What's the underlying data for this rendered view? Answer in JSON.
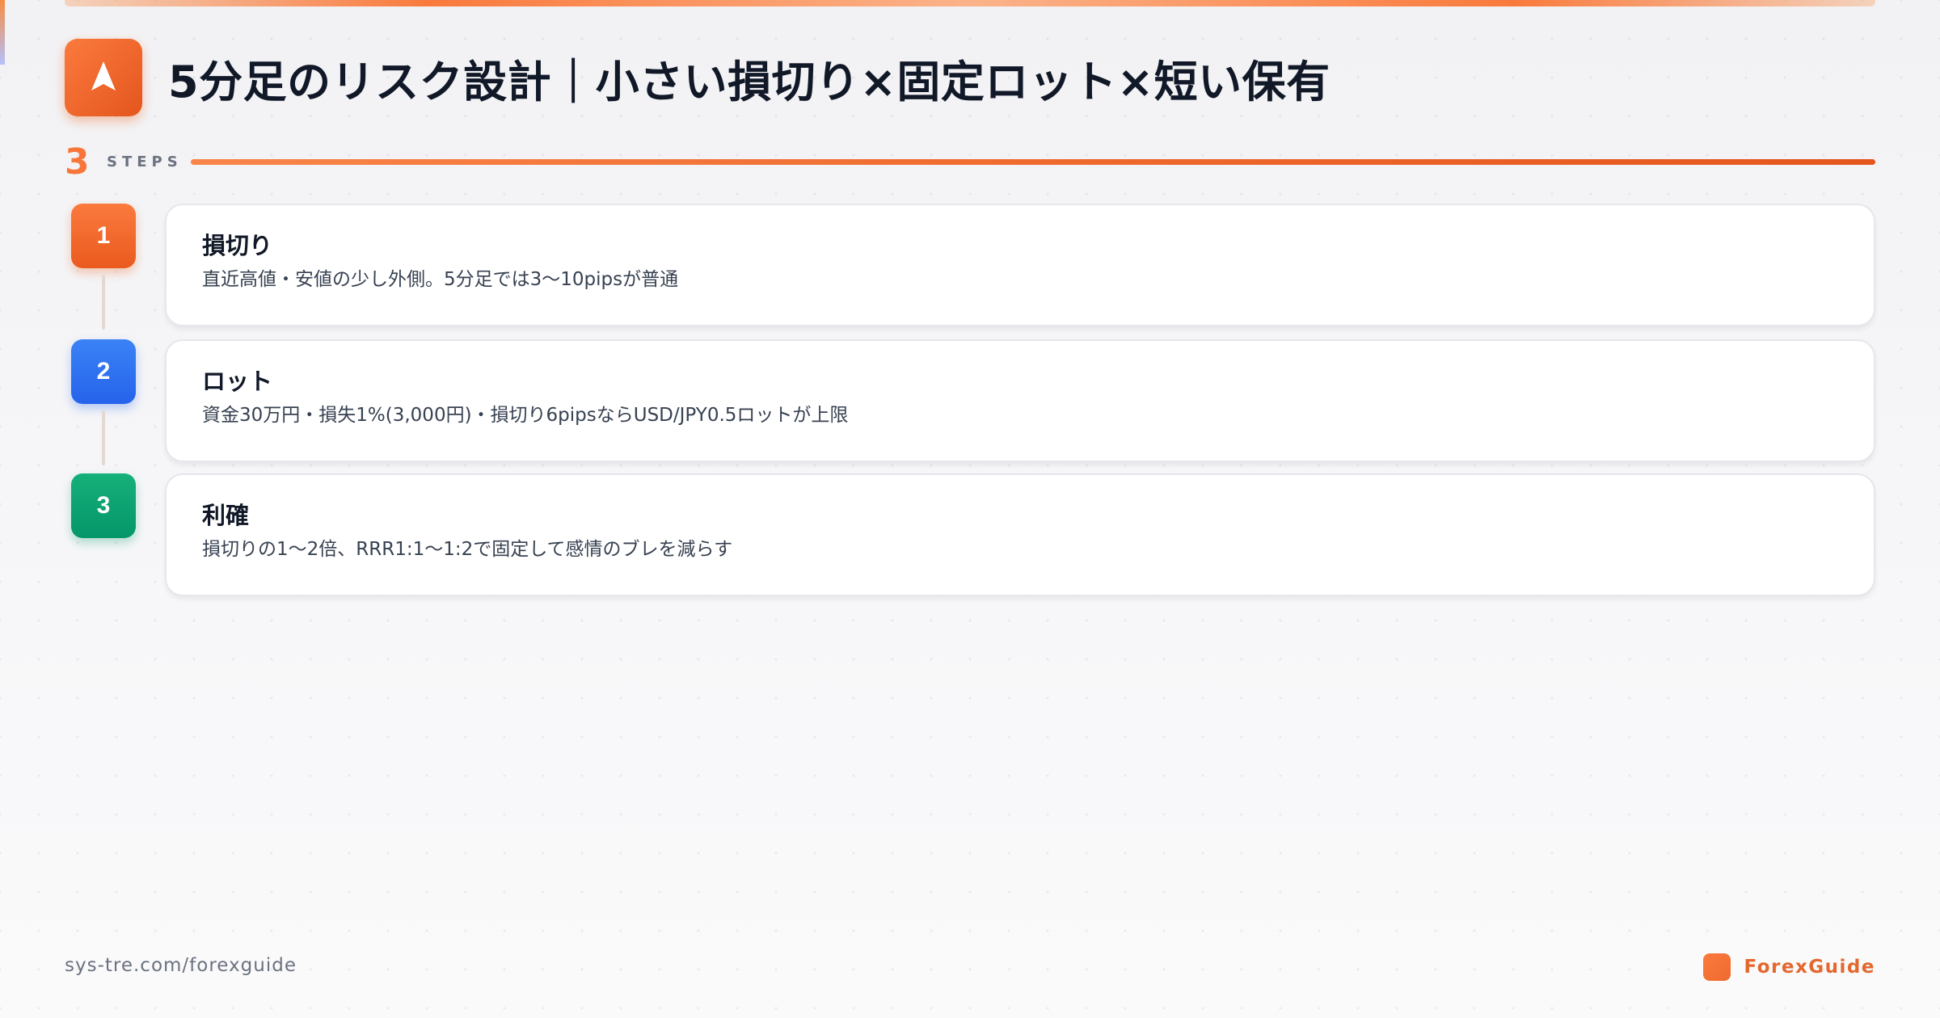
{
  "header": {
    "logo_icon": "navigation-arrow-icon",
    "title": "5分足のリスク設計｜小さい損切り×固定ロット×短い保有"
  },
  "steps_header": {
    "count": "3",
    "label": "STEPS"
  },
  "steps": [
    {
      "number": "1",
      "color": "#f26a2a",
      "title": "損切り",
      "description": "直近高値・安値の少し外側。5分足では3〜10pipsが普通"
    },
    {
      "number": "2",
      "color": "#2f6ff0",
      "title": "ロット",
      "description": "資金30万円・損失1%(3,000円)・損切り6pipsならUSD/JPY0.5ロットが上限"
    },
    {
      "number": "3",
      "color": "#0ea472",
      "title": "利確",
      "description": "損切りの1〜2倍、RRR1:1〜1:2で固定して感情のブレを減らす"
    }
  ],
  "footer": {
    "url": "sys-tre.com/forexguide",
    "brand": "ForexGuide",
    "brand_color": "#e4682e"
  }
}
